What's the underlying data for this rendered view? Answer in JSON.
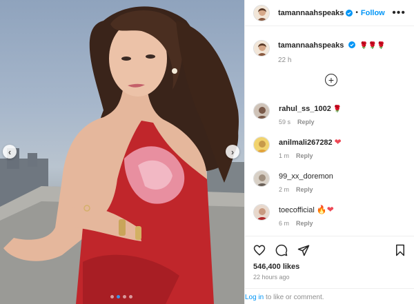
{
  "post": {
    "username": "tamannaahspeaks",
    "follow_label": "Follow",
    "caption_text": "🌹🌹🌹",
    "caption_time": "22 h",
    "likes": "546,400 likes",
    "posted": "22 hours ago",
    "login_link": "Log in",
    "login_rest": " to like or comment."
  },
  "media": {
    "slide_count": 4,
    "active_slide": 1,
    "prev_label": "‹",
    "next_label": "›"
  },
  "comments": [
    {
      "username": "rahul_ss_1002",
      "emoji": "🌹",
      "time": "59 s",
      "reply": "Reply",
      "avatar_color": "#7a5a4a"
    },
    {
      "username": "anilmali267282",
      "emoji": "❤",
      "time": "1 m",
      "reply": "Reply",
      "avatar_color": "#e8c04a"
    },
    {
      "username": "99_xx_doremon",
      "emoji": "",
      "time": "2 m",
      "reply": "Reply",
      "avatar_color": "#a09080"
    },
    {
      "username": "toecofficial",
      "emoji": "🔥❤",
      "time": "6 m",
      "reply": "Reply",
      "avatar_color": "#b02a2a"
    }
  ],
  "colors": {
    "accent": "#0095f6",
    "heart": "#ed4956",
    "dress": "#c0262b"
  }
}
